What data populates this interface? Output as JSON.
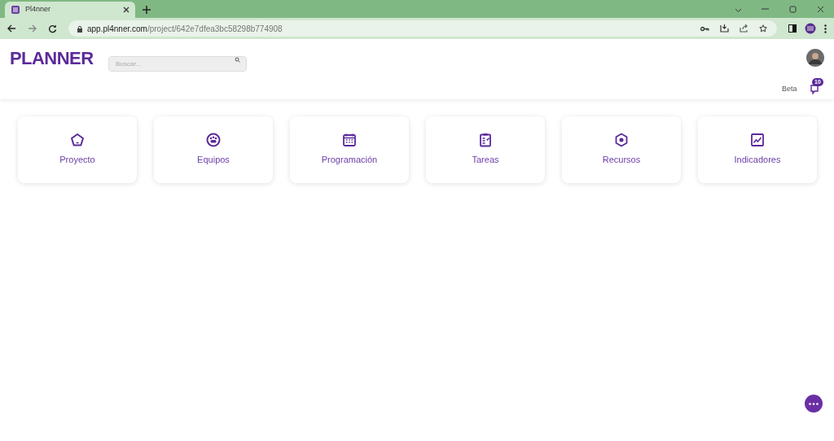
{
  "browser": {
    "tab_title": "Pl4nner",
    "url_host": "app.pl4nner.com",
    "url_path": "/project/642e7dfea3bc58298b774908"
  },
  "header": {
    "logo": "PLANNER",
    "search": {
      "placeholder": "Buscar..."
    },
    "beta": "Beta",
    "notifications": "10"
  },
  "cards": [
    {
      "label": "Proyecto",
      "kind": "pentagon"
    },
    {
      "label": "Equipos",
      "kind": "team"
    },
    {
      "label": "Programación",
      "kind": "calendar"
    },
    {
      "label": "Tareas",
      "kind": "clipboard"
    },
    {
      "label": "Recursos",
      "kind": "hexagon"
    },
    {
      "label": "Indicadores",
      "kind": "chart"
    }
  ]
}
